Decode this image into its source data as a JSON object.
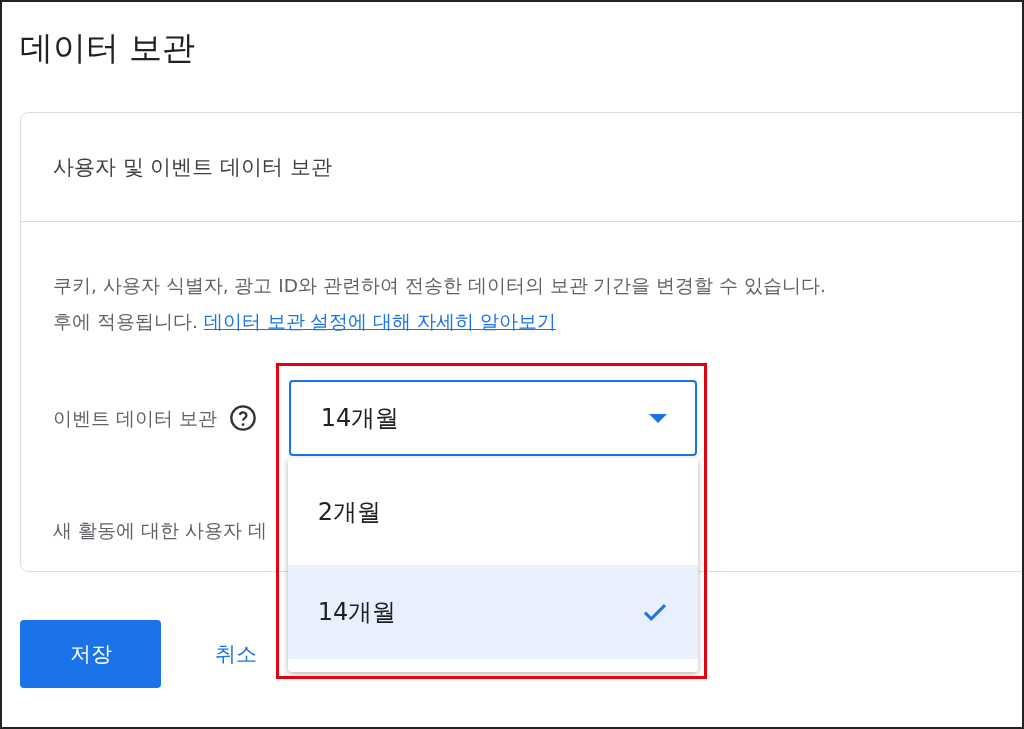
{
  "title": "데이터 보관",
  "card": {
    "heading": "사용자 및 이벤트 데이터 보관",
    "description": {
      "line": "쿠키, 사용자 식별자, 광고 ID와 관련하여 전송한 데이터의 보관 기간을 변경할 수 있습니다.",
      "tail": "후에 적용됩니다.",
      "link": "데이터 보관 설정에 대해 자세히 알아보기"
    },
    "event_retention": {
      "label": "이벤트 데이터 보관",
      "select": {
        "value": "14개월",
        "expanded": true,
        "options": [
          {
            "label": "2개월",
            "selected": false
          },
          {
            "label": "14개월",
            "selected": true
          }
        ]
      }
    },
    "reset_label": "새 활동에 대한 사용자 데"
  },
  "buttons": [
    {
      "label": "저장",
      "kind": "primary"
    },
    {
      "label": "취소",
      "kind": "text"
    }
  ]
}
